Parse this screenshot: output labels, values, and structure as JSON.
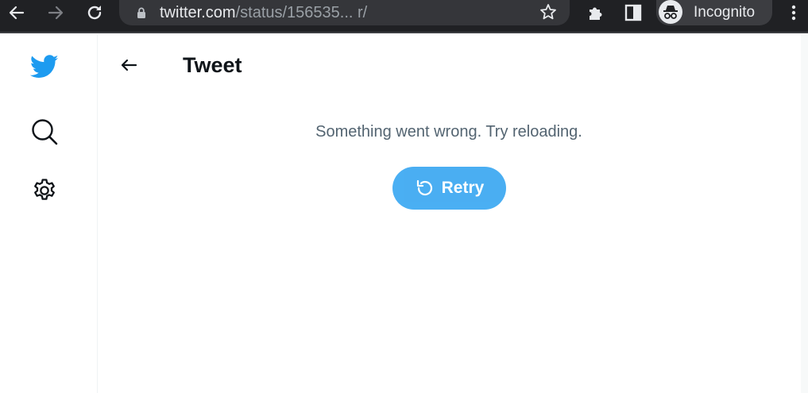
{
  "browser": {
    "url_host": "twitter.com",
    "url_path": "/status/156535... r/",
    "profile_label": "Incognito",
    "icons": [
      "back-arrow-icon",
      "forward-arrow-icon",
      "reload-icon",
      "lock-icon",
      "star-icon",
      "extensions-puzzle-icon",
      "side-panel-icon",
      "incognito-icon",
      "kebab-menu-icon"
    ]
  },
  "sidebar": {
    "icons": [
      "twitter-bird-icon",
      "search-icon",
      "settings-gear-icon"
    ]
  },
  "header": {
    "title": "Tweet"
  },
  "main": {
    "error_message": "Something went wrong. Try reloading.",
    "retry_label": "Retry"
  },
  "colors": {
    "toolbar_bg": "#202124",
    "twitter_blue": "#1d9bf0",
    "text_primary": "#0f1419",
    "text_secondary": "#536471"
  }
}
